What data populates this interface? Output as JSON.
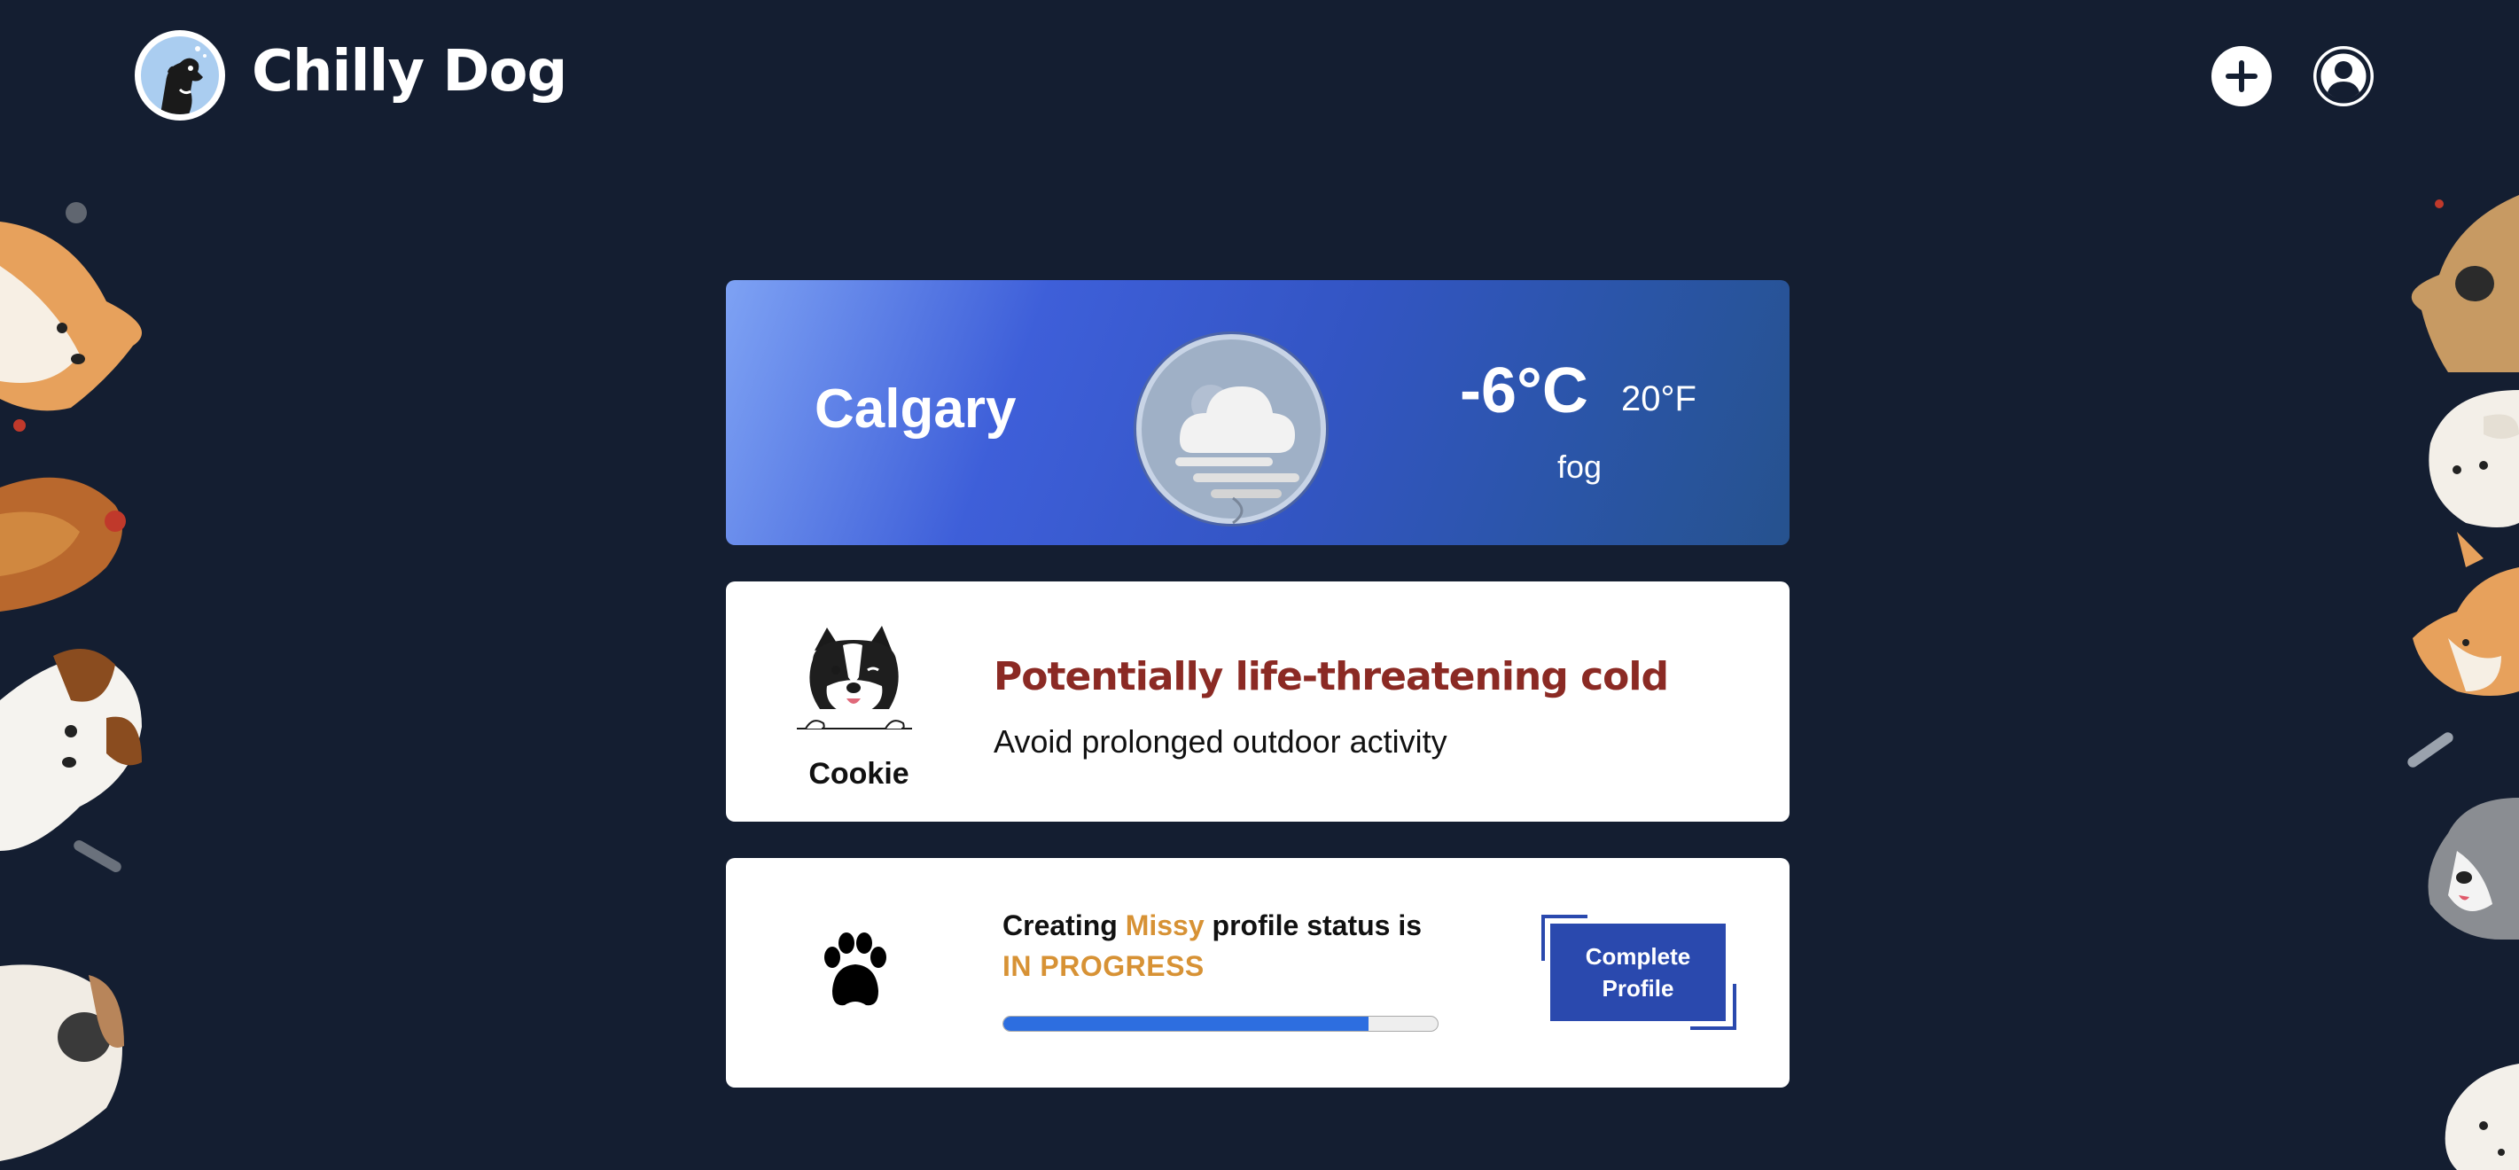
{
  "header": {
    "brand": "Chilly Dog",
    "add_icon": "plus-circle-icon",
    "account_icon": "user-circle-icon"
  },
  "weather": {
    "city": "Calgary",
    "temp_c": "-6°C",
    "temp_f": "20°F",
    "description": "fog",
    "icon": "fog-icon"
  },
  "alert": {
    "pet_name": "Cookie",
    "title": "Potentially life-threatening cold",
    "message": "Avoid prolonged outdoor activity"
  },
  "profile_status": {
    "prefix": "Creating ",
    "pet_name": "Missy",
    "suffix": " profile status is",
    "status": "IN PROGRESS",
    "progress": 0.84,
    "button_label": "Complete Profile"
  },
  "colors": {
    "background": "#141e31",
    "weather_gradient_start": "#7ea2f4",
    "weather_gradient_end": "#26528e",
    "alert_red": "#8b2a24",
    "highlight_orange": "#d79235",
    "button_blue": "#2a49ae",
    "progress_blue": "#2d6ee0"
  }
}
